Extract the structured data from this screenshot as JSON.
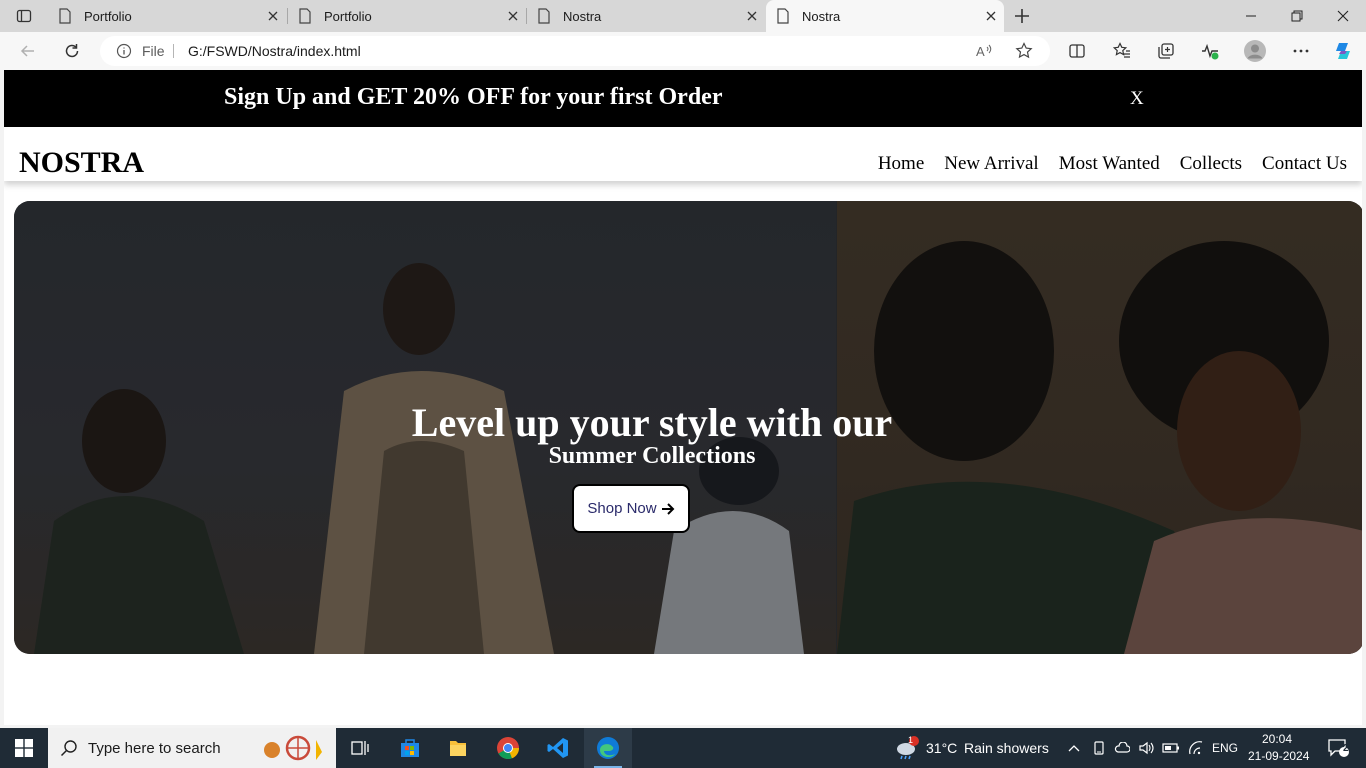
{
  "browser": {
    "tabs": [
      {
        "label": "Portfolio",
        "active": false
      },
      {
        "label": "Portfolio",
        "active": false
      },
      {
        "label": "Nostra",
        "active": false
      },
      {
        "label": "Nostra",
        "active": true
      }
    ],
    "address": {
      "scheme_label": "File",
      "url": "G:/FSWD/Nostra/index.html"
    }
  },
  "page": {
    "promo": {
      "text": "Sign Up and GET 20% OFF for your first Order",
      "close": "X"
    },
    "logo": "NOSTRA",
    "nav": [
      "Home",
      "New Arrival",
      "Most Wanted",
      "Collects",
      "Contact Us"
    ],
    "hero": {
      "title": "Level up your style with our",
      "subtitle": "Summer Collections",
      "button": "Shop Now"
    }
  },
  "taskbar": {
    "search_placeholder": "Type here to search",
    "weather": {
      "temp": "31°C",
      "condition": "Rain showers",
      "badge": "1"
    },
    "lang": "ENG",
    "time": "20:04",
    "date": "21-09-2024",
    "notifications": "2"
  }
}
